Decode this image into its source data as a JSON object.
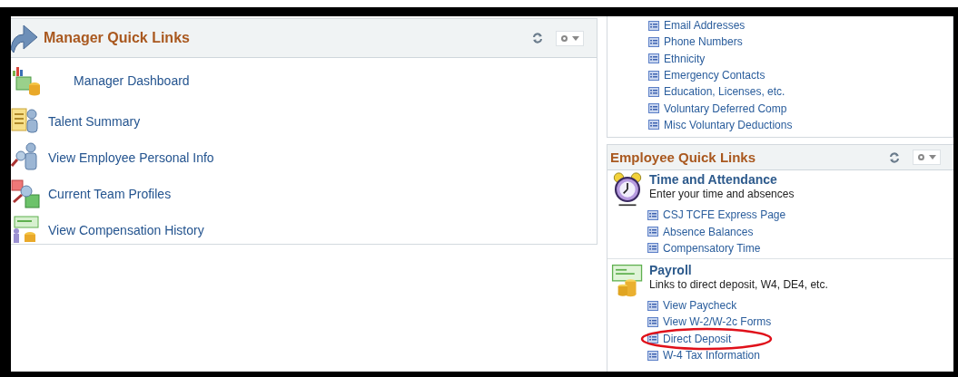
{
  "manager_quick_links": {
    "title": "Manager Quick Links",
    "items": [
      {
        "label": "Manager Dashboard"
      },
      {
        "label": "Talent Summary"
      },
      {
        "label": "View Employee Personal Info"
      },
      {
        "label": "Current Team Profiles"
      },
      {
        "label": "View Compensation History"
      }
    ]
  },
  "personal_links": [
    {
      "label": "Email Addresses"
    },
    {
      "label": "Phone Numbers"
    },
    {
      "label": "Ethnicity"
    },
    {
      "label": "Emergency Contacts"
    },
    {
      "label": "Education, Licenses, etc."
    },
    {
      "label": "Voluntary Deferred Comp"
    },
    {
      "label": "Misc Voluntary Deductions"
    }
  ],
  "employee_quick_links": {
    "title": "Employee Quick Links",
    "groups": [
      {
        "kind": "clock",
        "title": "Time and Attendance",
        "description": "Enter your time and absences",
        "links": [
          {
            "label": "CSJ TCFE Express Page",
            "highlighted": false
          },
          {
            "label": "Absence Balances",
            "highlighted": false
          },
          {
            "label": "Compensatory Time",
            "highlighted": false
          }
        ]
      },
      {
        "kind": "check",
        "title": "Payroll",
        "description": "Links to direct deposit, W4, DE4, etc.",
        "links": [
          {
            "label": "View Paycheck",
            "highlighted": false
          },
          {
            "label": "View W-2/W-2c Forms",
            "highlighted": false
          },
          {
            "label": "Direct Deposit",
            "highlighted": true
          },
          {
            "label": "W-4 Tax Information",
            "highlighted": false
          }
        ]
      }
    ]
  }
}
